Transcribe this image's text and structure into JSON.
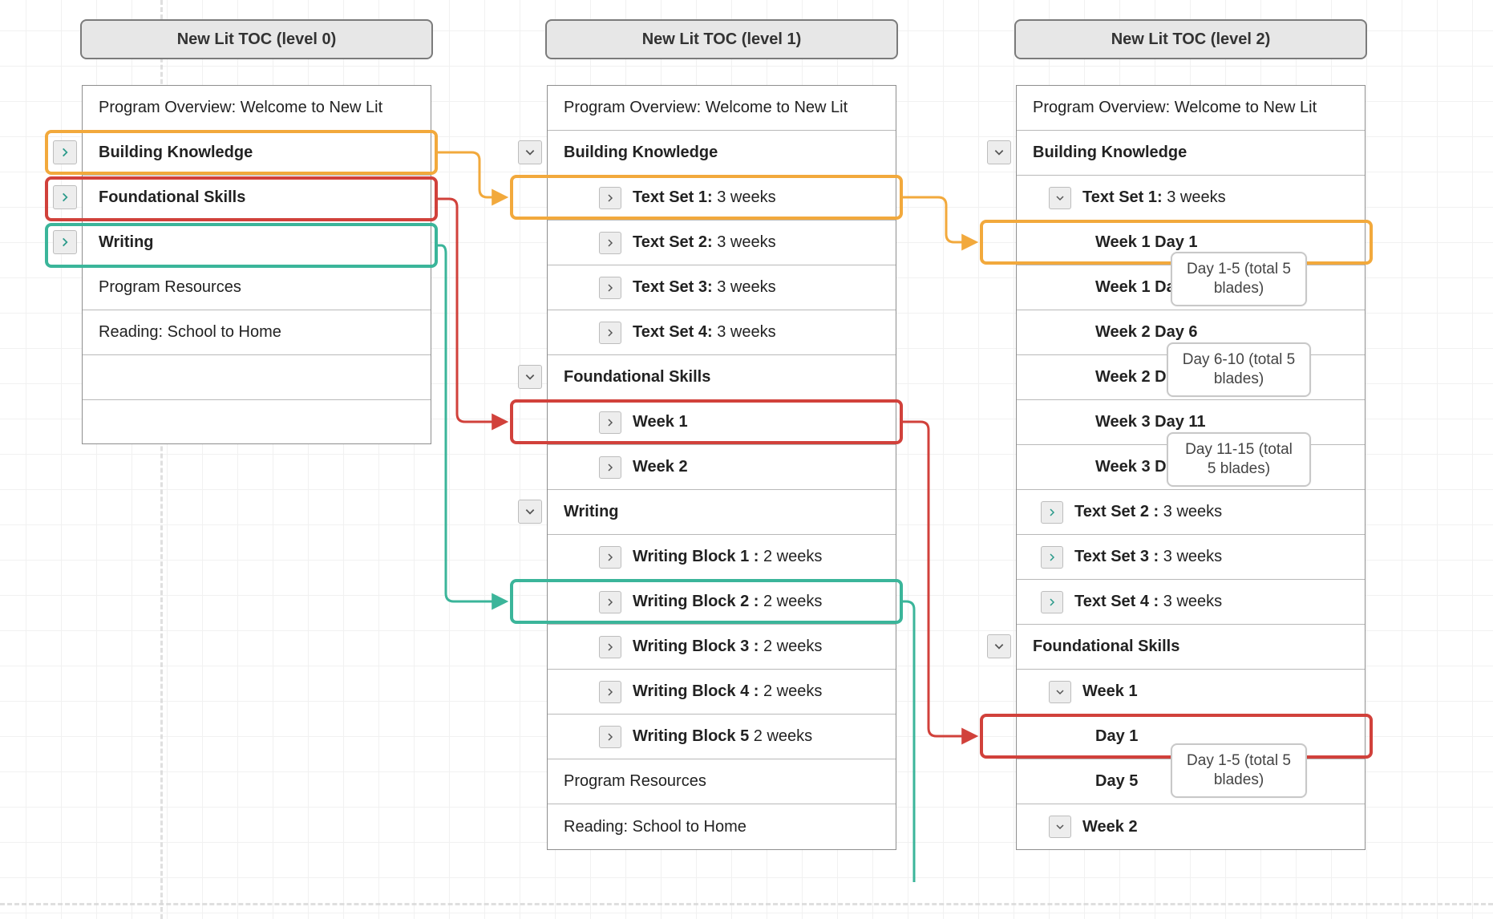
{
  "headers": {
    "level0": "New Lit TOC (level 0)",
    "level1": "New Lit TOC (level 1)",
    "level2": "New Lit TOC (level 2)"
  },
  "col0": {
    "overview": "Program Overview: Welcome to New Lit",
    "building": "Building Knowledge",
    "foundational": "Foundational Skills",
    "writing": "Writing",
    "resources": "Program Resources",
    "reading": "Reading: School to Home"
  },
  "col1": {
    "overview": "Program Overview: Welcome to New Lit",
    "building": "Building Knowledge",
    "ts1_b": "Text Set 1:",
    "ts1_n": " 3 weeks",
    "ts2_b": "Text Set 2:",
    "ts2_n": " 3 weeks",
    "ts3_b": "Text Set 3:",
    "ts3_n": " 3 weeks",
    "ts4_b": "Text Set 4:",
    "ts4_n": " 3 weeks",
    "foundational": "Foundational Skills",
    "wk1": "Week 1",
    "wk2": "Week 2",
    "writing": "Writing",
    "wb1_b": "Writing Block 1 :",
    "wb1_n": " 2 weeks",
    "wb2_b": "Writing Block 2 :",
    "wb2_n": " 2 weeks",
    "wb3_b": "Writing Block 3 :",
    "wb3_n": " 2 weeks",
    "wb4_b": "Writing Block 4 :",
    "wb4_n": " 2 weeks",
    "wb5_b": "Writing Block 5",
    "wb5_n": " 2 weeks",
    "resources": "Program Resources",
    "reading": "Reading: School to Home"
  },
  "col2": {
    "overview": "Program Overview: Welcome to New Lit",
    "building": "Building Knowledge",
    "ts1_b": "Text Set 1:",
    "ts1_n": " 3 weeks",
    "w1d1": "Week 1 Day 1",
    "w1d5": "Week 1 Day 5",
    "w2d6": "Week 2 Day 6",
    "w2d10": "Week 2 Day 10",
    "w3d11": "Week 3 Day 11",
    "w3d15": "Week 3 Day 15",
    "ts2_b": "Text Set 2 :",
    "ts2_n": " 3 weeks",
    "ts3_b": "Text Set 3 :",
    "ts3_n": " 3 weeks",
    "ts4_b": "Text Set 4 :",
    "ts4_n": " 3 weeks",
    "foundational": "Foundational Skills",
    "wk1": "Week 1",
    "d1": "Day 1",
    "d5": "Day 5",
    "wk2": "Week 2"
  },
  "callouts": {
    "d1_5": "Day 1-5 (total 5 blades)",
    "d6_10": "Day 6-10 (total 5 blades)",
    "d11_15": "Day 11-15 (total 5 blades)",
    "fs_d1_5": "Day 1-5 (total 5 blades)"
  }
}
